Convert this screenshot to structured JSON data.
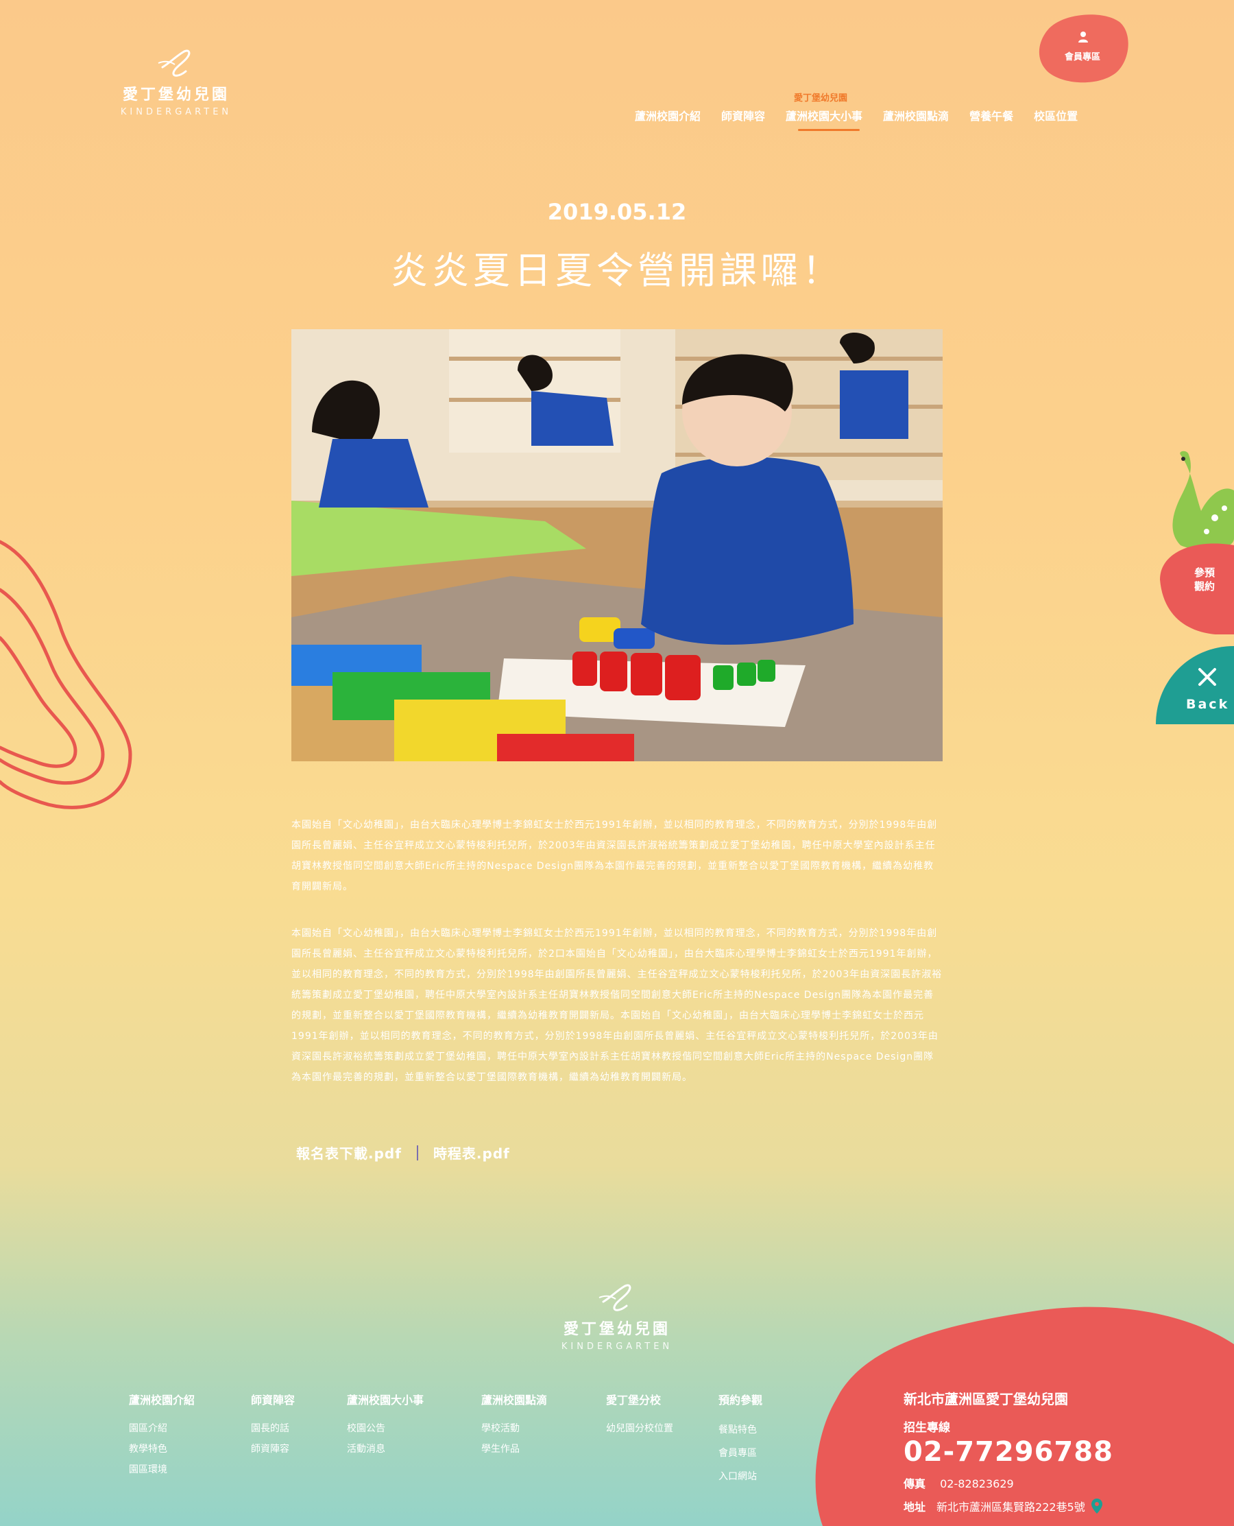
{
  "header": {
    "logo_name": "愛丁堡幼兒園",
    "logo_sub": "KINDERGARTEN",
    "member_label": "會員專區",
    "nav_super": "愛丁堡幼兒園",
    "nav": [
      "蘆洲校園介紹",
      "師資陣容",
      "蘆洲校園大小事",
      "蘆洲校園點滴",
      "營養午餐",
      "校區位置"
    ]
  },
  "article": {
    "date": "2019.05.12",
    "title": "炎炎夏日夏令營開課囉！",
    "para1": "本園始自「文心幼稚園」，由台大臨床心理學博士李錦虹女士於西元1991年創辦，並以相同的教育理念，不同的教育方式，分別於1998年由創園所長曾麗娟、主任谷宜秤成立文心蒙特梭利托兒所，於2003年由資深園長許淑裕統籌策劃成立愛丁堡幼稚園，聘任中原大學室內設計系主任胡寶林教授偕同空間創意大師Eric所主持的Nespace Design團隊為本園作最完善的規劃，並重新整合以愛丁堡國際教育機構，繼續為幼稚教育開闢新局。",
    "para2": "本園始自「文心幼稚園」，由台大臨床心理學博士李錦虹女士於西元1991年創辦，並以相同的教育理念，不同的教育方式，分別於1998年由創園所長曾麗娟、主任谷宜秤成立文心蒙特梭利托兒所，於2口本園始自「文心幼稚園」，由台大臨床心理學博士李錦虹女士於西元1991年創辦，並以相同的教育理念，不同的教育方式，分別於1998年由創園所長曾麗娟、主任谷宜秤成立文心蒙特梭利托兒所，於2003年由資深園長許淑裕統籌策劃成立愛丁堡幼稚園，聘任中原大學室內設計系主任胡寶林教授偕同空間創意大師Eric所主持的Nespace Design團隊為本園作最完善的規劃，並重新整合以愛丁堡國際教育機構，繼續為幼稚教育開闢新局。本園始自「文心幼稚園」，由台大臨床心理學博士李錦虹女士於西元1991年創辦，並以相同的教育理念，不同的教育方式，分別於1998年由創園所長曾麗娟、主任谷宜秤成立文心蒙特梭利托兒所，於2003年由資深園長許淑裕統籌策劃成立愛丁堡幼稚園，聘任中原大學室內設計系主任胡寶林教授偕同空間創意大師Eric所主持的Nespace Design團隊為本園作最完善的規劃，並重新整合以愛丁堡國際教育機構，繼續為幼稚教育開闢新局。",
    "download1": "報名表下載.pdf",
    "download2": "時程表.pdf"
  },
  "side": {
    "visit_label_1": "參預",
    "visit_label_2": "觀約",
    "back_label": "Back"
  },
  "footer": {
    "logo_name": "愛丁堡幼兒園",
    "logo_sub": "KINDERGARTEN",
    "columns": [
      {
        "title": "蘆洲校園介紹",
        "items": [
          "園區介紹",
          "教學特色",
          "園區環境"
        ]
      },
      {
        "title": "師資陣容",
        "items": [
          "園長的話",
          "師資陣容"
        ]
      },
      {
        "title": "蘆洲校園大小事",
        "items": [
          "校園公告",
          "活動消息"
        ]
      },
      {
        "title": "蘆洲校園點滴",
        "items": [
          "學校活動",
          "學生作品"
        ]
      },
      {
        "title": "愛丁堡分校",
        "items": [
          "幼兒園分校位置"
        ]
      },
      {
        "title": "預約參觀",
        "items": [
          "餐點特色",
          "會員專區",
          "入口網站"
        ]
      }
    ],
    "contact": {
      "school": "新北市蘆洲區愛丁堡幼兒園",
      "hotline_label": "招生專線",
      "phone": "02-77296788",
      "fax_label": "傳真",
      "fax": "02-82823629",
      "addr_label": "地址",
      "addr": "新北市蘆洲區集賢路222巷5號"
    }
  },
  "colors": {
    "accent": "#f07a2b",
    "coral": "#ea5a57",
    "teal": "#1f9e93"
  },
  "icons": [
    "logo-e-icon",
    "user-icon",
    "dinosaur-icon",
    "close-x-icon",
    "map-pin-icon"
  ]
}
